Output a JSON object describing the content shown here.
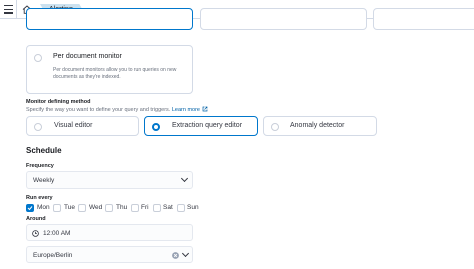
{
  "header": {
    "breadcrumb": "Alerting",
    "menu_icon": "hamburger-icon",
    "home_icon": "home-icon"
  },
  "per_document": {
    "title": "Per document monitor",
    "description": "Per document monitors allow you to run queries on new documents as they're indexed."
  },
  "defining_method": {
    "label": "Monitor defining method",
    "help": "Specify the way you want to define your query and triggers.",
    "learn_more": "Learn more",
    "options": [
      {
        "label": "Visual editor",
        "selected": false
      },
      {
        "label": "Extraction query editor",
        "selected": true
      },
      {
        "label": "Anomaly detector",
        "selected": false
      }
    ]
  },
  "schedule": {
    "heading": "Schedule",
    "frequency_label": "Frequency",
    "frequency_value": "Weekly",
    "run_every_label": "Run every",
    "days": [
      {
        "label": "Mon",
        "checked": true
      },
      {
        "label": "Tue",
        "checked": false
      },
      {
        "label": "Wed",
        "checked": false
      },
      {
        "label": "Thu",
        "checked": false
      },
      {
        "label": "Fri",
        "checked": false
      },
      {
        "label": "Sat",
        "checked": false
      },
      {
        "label": "Sun",
        "checked": false
      }
    ],
    "around_label": "Around",
    "time_value": "12:00 AM",
    "timezone_value": "Europe/Berlin"
  },
  "colors": {
    "accent": "#0077cc",
    "breadcrumb_bg": "#cbe1ef"
  }
}
